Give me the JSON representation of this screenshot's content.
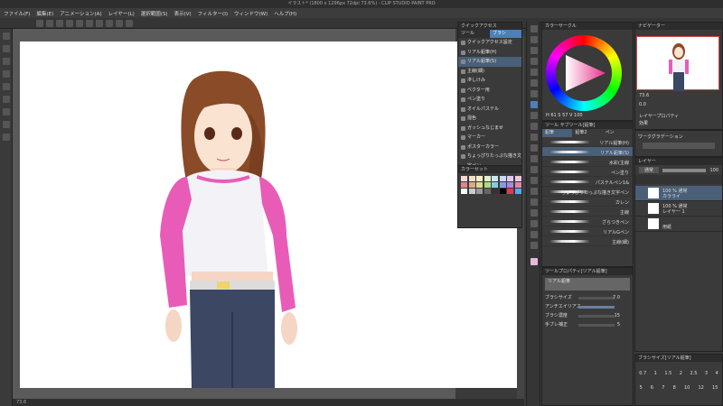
{
  "window": {
    "title": "イラスト* (1800 x 1296px 72dpi 73.6%) - CLIP STUDIO PAINT PRO"
  },
  "menu": [
    "ファイル(F)",
    "編集(E)",
    "アニメーション(A)",
    "レイヤー(L)",
    "選択範囲(S)",
    "表示(V)",
    "フィルター(I)",
    "ウィンドウ(W)",
    "ヘルプ(H)"
  ],
  "quickaccess": {
    "header": "クイックアクセス",
    "tabs": [
      "ツール",
      "ブラシ"
    ],
    "items": [
      "クイックアクセス設定",
      "リアル鉛筆(H)",
      "リアル鉛筆(S)",
      "主線(細)",
      "滲しけみ",
      "ベクター用",
      "ペン塗り",
      "オイルパステル",
      "混色",
      "ガッシュなじませ",
      "マーカー",
      "ポスターカラー",
      "ちょっぴりたっぷな描き文字ペン"
    ]
  },
  "swatches": {
    "header": "カラーセット"
  },
  "colorwheel": {
    "header": "カラーサークル",
    "info": "H 61 S 57 V 100"
  },
  "subtool": {
    "header": "ツール  サブツール[鉛筆]",
    "tabs": [
      "鉛筆",
      "鉛筆2",
      "ペン"
    ],
    "brushes": [
      "リアル鉛筆(H)",
      "リアル鉛筆(S)",
      "水彩(主線",
      "ペン塗り",
      "パステルペン1&",
      "ちょっぴりたっぷな描き文字ペン",
      "カレン",
      "主線",
      "ざらつきペン",
      "リアルGペン",
      "主線(細)"
    ]
  },
  "toolprop": {
    "header": "ツールプロパティ[リアル鉛筆]",
    "name": "リアル鉛筆",
    "rows": [
      {
        "label": "ブラシサイズ",
        "value": "7.0"
      },
      {
        "label": "アンチエイリアス",
        "value": ""
      },
      {
        "label": "ブラシ濃度",
        "value": "15"
      },
      {
        "label": "手ブレ補正",
        "value": "5"
      }
    ]
  },
  "navigator": {
    "header": "ナビゲーター",
    "zoom": "73.6",
    "angle": "0.0"
  },
  "layerprop": {
    "header": "レイヤープロパティ",
    "effect": "効果",
    "gradation": "ワークグラデーション"
  },
  "layers": {
    "header": "レイヤー",
    "blend": "通常",
    "opacity": "100",
    "items": [
      {
        "n1": "100 % 通常",
        "n2": "カラライ"
      },
      {
        "n1": "100 % 通常",
        "n2": "レイヤー 1"
      },
      {
        "n1": "",
        "n2": "用紙"
      }
    ]
  },
  "brushsize": {
    "header": "ブラシサイズ[リアル鉛筆]",
    "values": [
      "0.7",
      "1",
      "1.5",
      "2",
      "2.5",
      "3",
      "4"
    ],
    "values2": [
      "5",
      "6",
      "7",
      "8",
      "10",
      "12",
      "15"
    ]
  },
  "status": {
    "zoom": "73.6"
  }
}
